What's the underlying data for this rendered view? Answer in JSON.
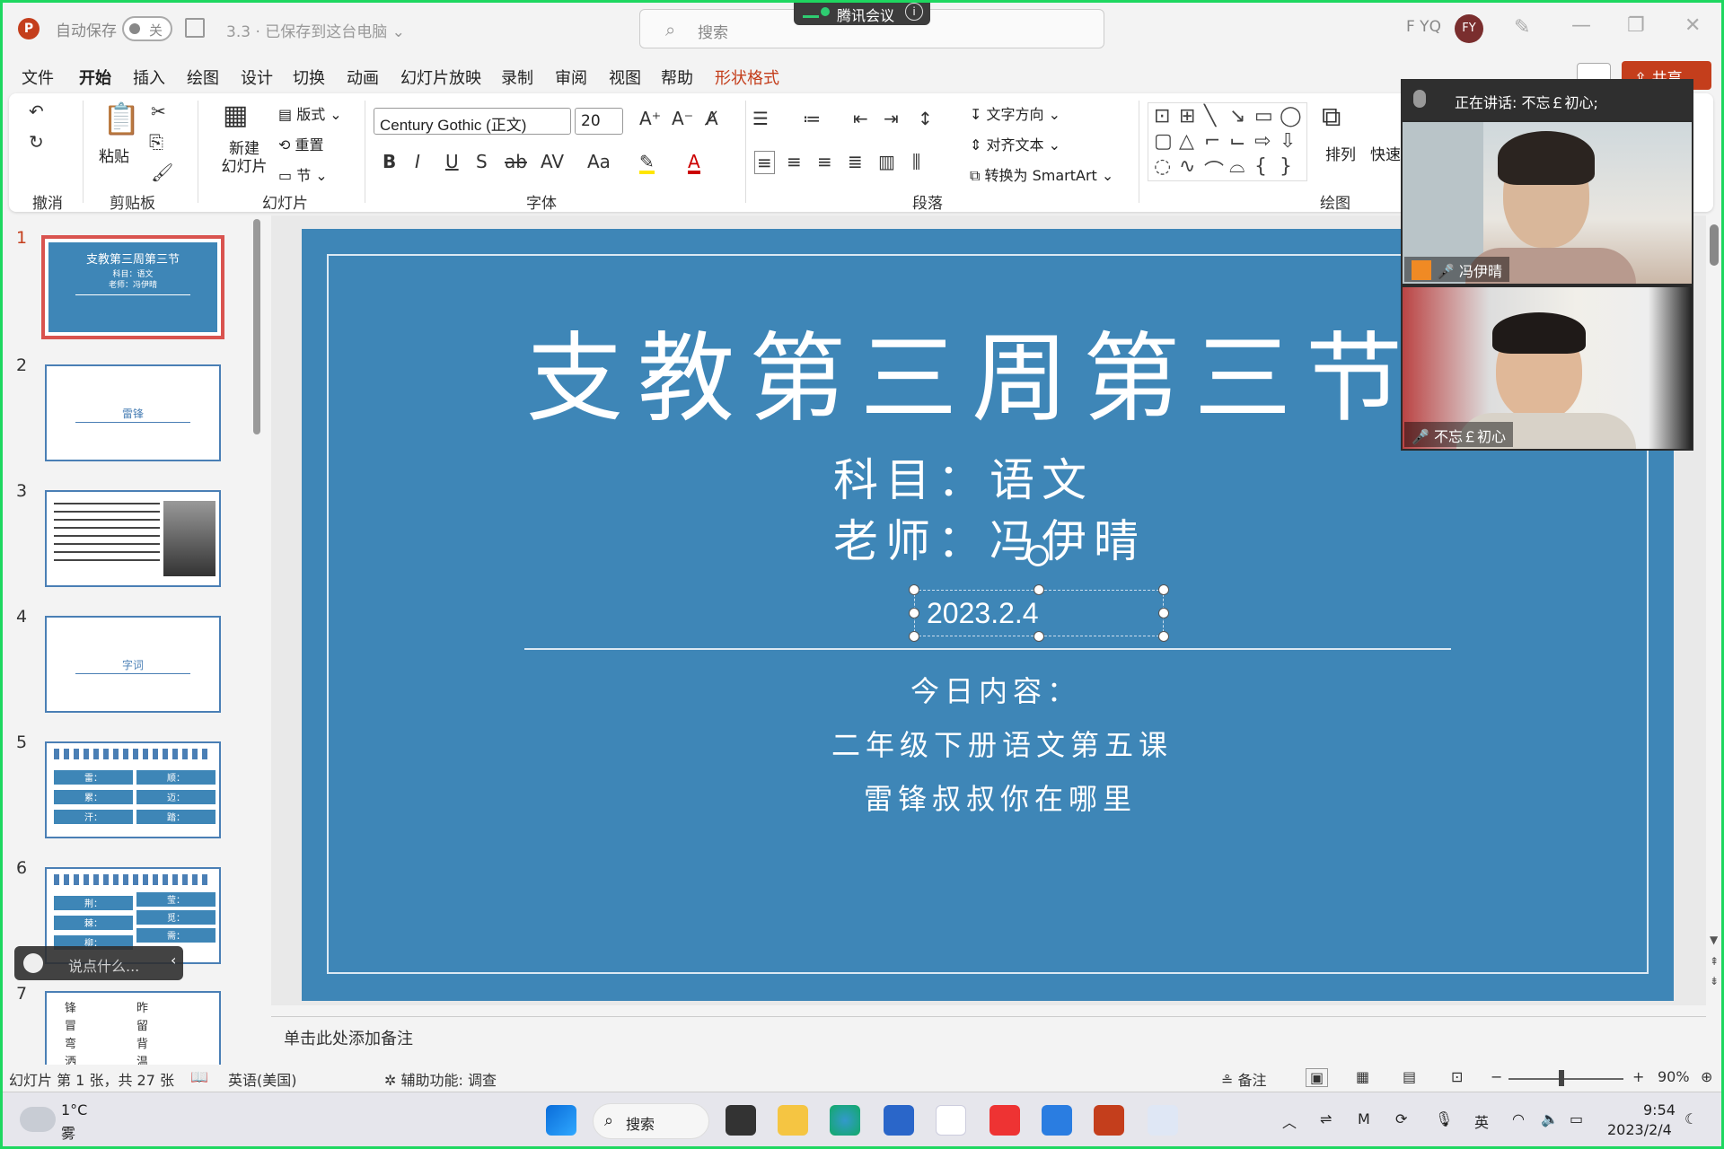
{
  "titlebar": {
    "autosave_label": "自动保存",
    "autosave_state": "关",
    "doc_name": "3.3 · 已保存到这台电脑 ⌄",
    "search_placeholder": "搜索",
    "meeting_label": "腾讯会议",
    "user_initials_text": "F YQ",
    "avatar_initials": "FY"
  },
  "menu": {
    "items": [
      "文件",
      "开始",
      "插入",
      "绘图",
      "设计",
      "切换",
      "动画",
      "幻灯片放映",
      "录制",
      "审阅",
      "视图",
      "帮助",
      "形状格式"
    ],
    "active": "开始",
    "share_label": "共享"
  },
  "ribbon": {
    "groups": {
      "undo": "撤消",
      "clipboard": "剪贴板",
      "slides": "幻灯片",
      "font": "字体",
      "paragraph": "段落",
      "drawing": "绘图"
    },
    "paste_label": "粘贴",
    "new_slide_label": "新建\n幻灯片",
    "layout_label": "版式",
    "reset_label": "重置",
    "section_label": "节",
    "font_name": "Century Gothic (正文)",
    "font_size": "20",
    "text_direction_label": "文字方向",
    "align_text_label": "对齐文本",
    "smartart_label": "转换为 SmartArt",
    "arrange_label": "排列",
    "quick_styles_label": "快速"
  },
  "thumbnails": [
    {
      "num": "1",
      "title": "支教第三周第三节",
      "sub1": "科目：语文",
      "sub2": "老师：冯伊晴"
    },
    {
      "num": "2",
      "text": "雷锋"
    },
    {
      "num": "3"
    },
    {
      "num": "4",
      "text": "字词"
    },
    {
      "num": "5",
      "cells": [
        "雷：",
        "顺：",
        "累：",
        "迈：",
        "汗：",
        "踏："
      ]
    },
    {
      "num": "6",
      "cells": [
        "荆：",
        "莹：",
        "棘：",
        "觅：",
        "柳：",
        "需："
      ]
    },
    {
      "num": "7",
      "chars": [
        "锋",
        "昨",
        "冒",
        "留",
        "弯",
        "背",
        "洒",
        "温"
      ]
    }
  ],
  "chat_pill": {
    "text": "说点什么..."
  },
  "slide": {
    "title": "支教第三周第三节",
    "subject": "科目：语文",
    "teacher": "老师：冯伊晴",
    "date": "2023.2.4",
    "today": "今日内容：",
    "lesson1": "二年级下册语文第五课",
    "lesson2": "雷锋叔叔你在哪里"
  },
  "notes_placeholder": "单击此处添加备注",
  "status": {
    "slide_info": "幻灯片 第 1 张，共 27 张",
    "language": "英语(美国)",
    "accessibility": "辅助功能: 调查",
    "notes": "备注",
    "zoom": "90%",
    "zoom_level_percent": 90
  },
  "video": {
    "speaking": "正在讲话: 不忘￡初心;",
    "participants": [
      {
        "name": "冯伊晴"
      },
      {
        "name": "不忘￡初心"
      }
    ]
  },
  "taskbar": {
    "weather_temp": "1°C",
    "weather_desc": "雾",
    "search_label": "搜索",
    "ime": "英",
    "time": "9:54",
    "date": "2023/2/4"
  },
  "colors": {
    "slide_bg": "#3e86b7",
    "accent": "#c43e1c",
    "frame": "#1ed760"
  }
}
